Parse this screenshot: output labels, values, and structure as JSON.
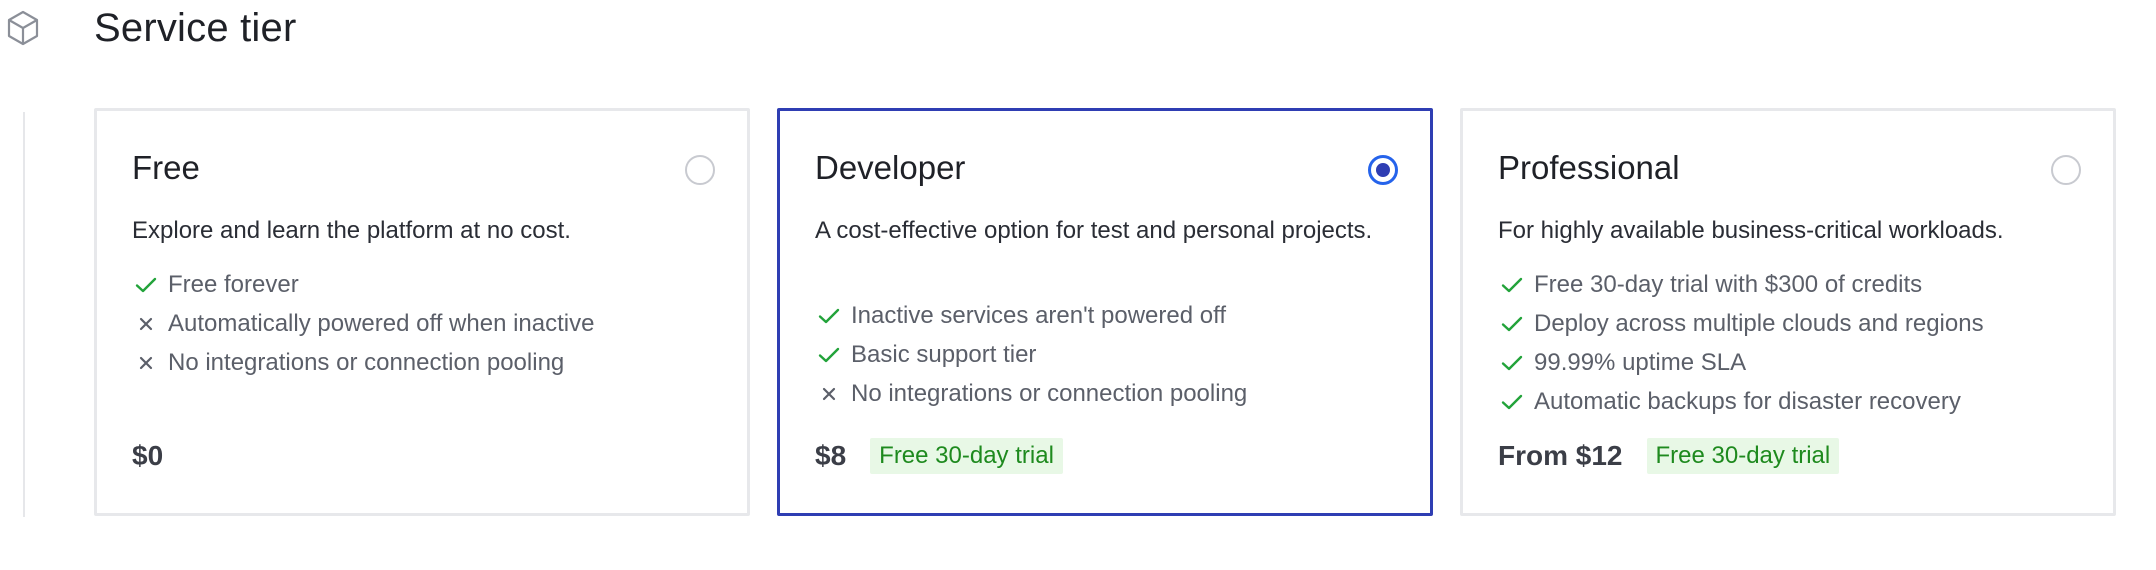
{
  "header": {
    "title": "Service tier",
    "icon": "cube-icon"
  },
  "colors": {
    "selected_border": "#2f3eb3",
    "check": "#22a33a",
    "cross": "#5b5f69",
    "trial_bg": "#e8f8e6",
    "trial_text": "#1e8a1e"
  },
  "tiers": [
    {
      "title": "Free",
      "selected": false,
      "description": "Explore and learn the platform at no cost.",
      "features": [
        {
          "icon": "check-icon",
          "text": "Free forever"
        },
        {
          "icon": "cross-icon",
          "text": "Automatically powered off when inactive"
        },
        {
          "icon": "cross-icon",
          "text": "No integrations or connection pooling"
        }
      ],
      "price": "$0",
      "trial": ""
    },
    {
      "title": "Developer",
      "selected": true,
      "description": "A cost-effective option for test and personal projects.",
      "features": [
        {
          "icon": "check-icon",
          "text": "Inactive services aren't powered off"
        },
        {
          "icon": "check-icon",
          "text": "Basic support tier"
        },
        {
          "icon": "cross-icon",
          "text": "No integrations or connection pooling"
        }
      ],
      "price": "$8",
      "trial": "Free 30-day trial"
    },
    {
      "title": "Professional",
      "selected": false,
      "description": "For highly available business-critical workloads.",
      "features": [
        {
          "icon": "check-icon",
          "text": "Free 30-day trial with $300 of credits"
        },
        {
          "icon": "check-icon",
          "text": "Deploy across multiple clouds and regions"
        },
        {
          "icon": "check-icon",
          "text": "99.99% uptime SLA"
        },
        {
          "icon": "check-icon",
          "text": "Automatic backups for disaster recovery"
        }
      ],
      "price": "From $12",
      "trial": "Free 30-day trial"
    }
  ]
}
